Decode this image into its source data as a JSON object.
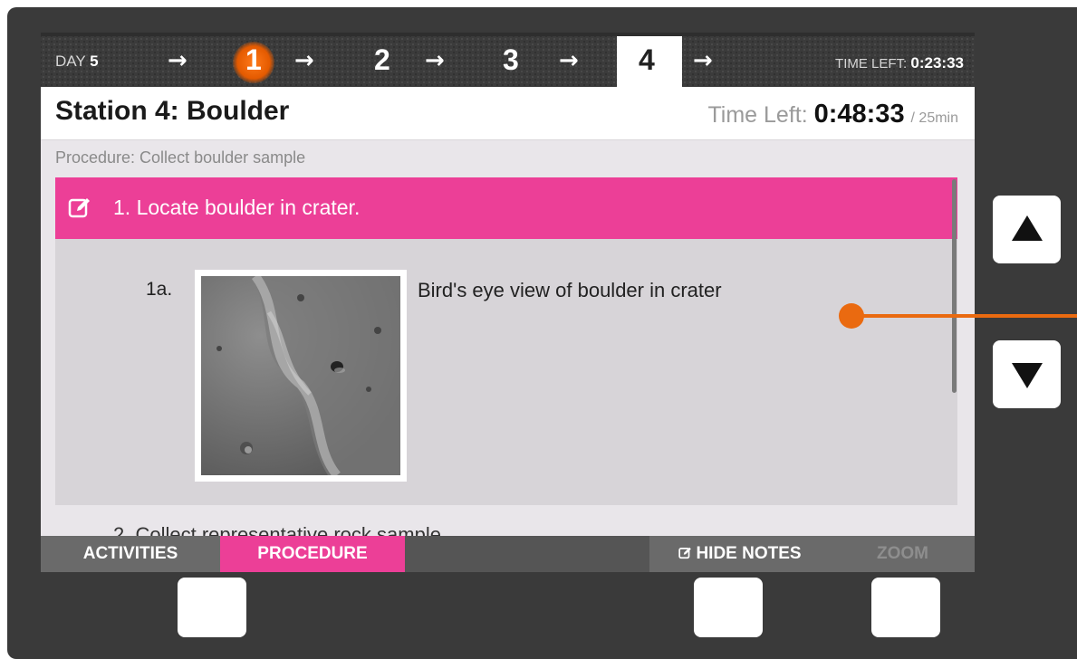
{
  "topbar": {
    "day_label": "DAY",
    "day_number": "5",
    "steps": [
      "1",
      "2",
      "3",
      "4"
    ],
    "arrow": "→",
    "time_left_label": "TIME LEFT:",
    "time_left_value": "0:23:33",
    "active_step_color": "#e45a00"
  },
  "station": {
    "title": "Station 4: Boulder",
    "time_left_label": "Time Left:",
    "time_left_value": "0:48:33",
    "duration": "/ 25min"
  },
  "procedure": {
    "label": "Procedure: Collect boulder sample",
    "current_step": {
      "icon": "edit-icon",
      "text": "1. Locate boulder in crater.",
      "color": "#ec3f97"
    },
    "substep": {
      "number": "1a.",
      "caption": "Bird's eye view of boulder in crater",
      "image": "crater-photo"
    },
    "next_step_partial": "2. Collect representative rock sample"
  },
  "tabs": {
    "activities": "ACTIVITIES",
    "procedure": "PROCEDURE",
    "hide_notes": "HIDE NOTES",
    "zoom": "ZOOM"
  },
  "hardware": {
    "up_icon": "triangle-up-icon",
    "down_icon": "triangle-down-icon"
  },
  "annotation": {
    "color": "#ea6a10"
  }
}
